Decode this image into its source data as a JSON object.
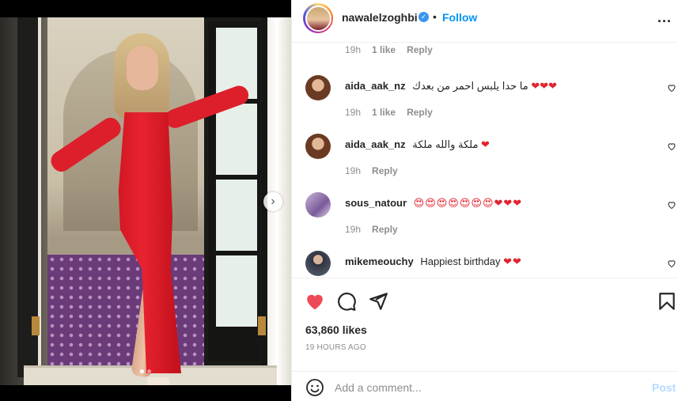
{
  "post": {
    "author": "nawalelzoghbi",
    "separator": "•",
    "follow_label": "Follow",
    "more_label": "...",
    "verified_glyph": "✓",
    "next_glyph": "›",
    "likes": "63,860 likes",
    "time_ago": "19 HOURS AGO"
  },
  "top_meta": {
    "time": "19h",
    "likes": "1 like",
    "reply": "Reply"
  },
  "comments": [
    {
      "username": "aida_aak_nz",
      "text": "ما حدا يلبس احمر من بعدك",
      "emoji": "❤❤❤",
      "time": "19h",
      "likes": "1 like",
      "reply": "Reply"
    },
    {
      "username": "aida_aak_nz",
      "text": "ملكة والله ملكة",
      "emoji": "❤",
      "time": "19h",
      "reply": "Reply"
    },
    {
      "username": "sous_natour",
      "text": "",
      "emoji": "😍😍😍😍😍😍😍❤❤❤",
      "time": "19h",
      "reply": "Reply"
    },
    {
      "username": "mikemeouchy",
      "text": "Happiest birthday",
      "emoji": "❤❤",
      "time": "",
      "reply": ""
    }
  ],
  "add_comment": {
    "placeholder": "Add a comment...",
    "post_label": "Post"
  },
  "colors": {
    "like_red": "#ed4956",
    "accent_blue": "#0095f6",
    "post_disabled": "#b3dbff"
  },
  "icons": [
    "heart-icon",
    "comment-icon",
    "share-icon",
    "bookmark-icon",
    "smiley-icon",
    "verified-icon",
    "more-icon",
    "chevron-right-icon"
  ]
}
